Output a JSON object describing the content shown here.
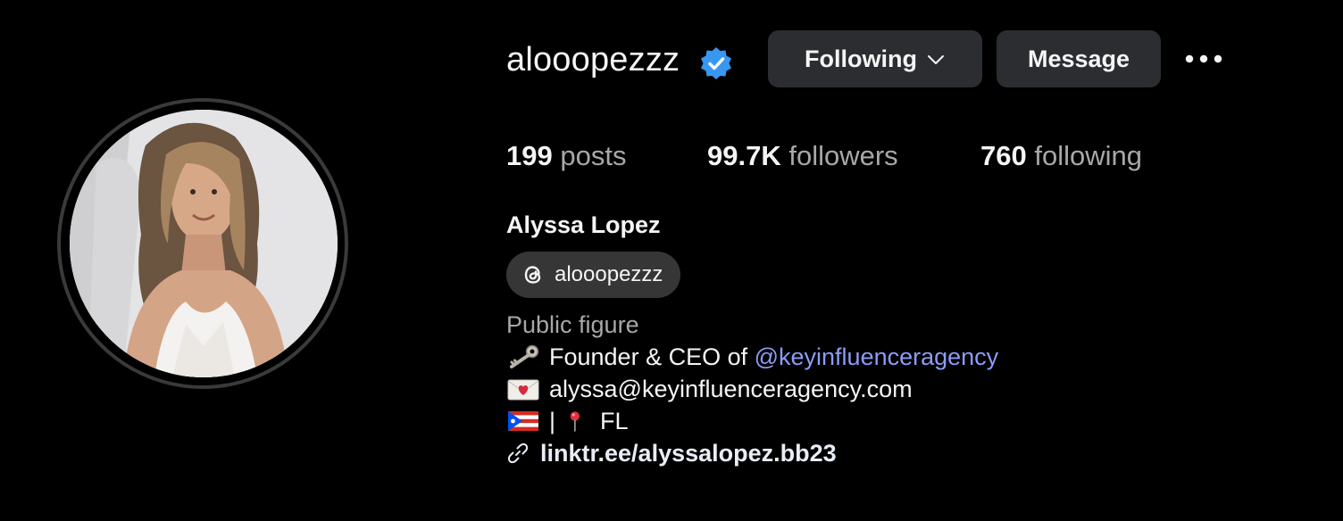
{
  "profile": {
    "username": "alooopezzz",
    "verified": true,
    "full_name": "Alyssa Lopez",
    "category": "Public figure"
  },
  "actions": {
    "following_label": "Following",
    "message_label": "Message",
    "more_icon": "more-horizontal-icon"
  },
  "stats": {
    "posts_count": "199",
    "posts_label": "posts",
    "followers_count": "99.7K",
    "followers_label": "followers",
    "following_count": "760",
    "following_label": "following"
  },
  "threads": {
    "handle": "alooopezzz",
    "icon": "threads-icon"
  },
  "bio": {
    "line1_prefix": "Founder & CEO of ",
    "line1_mention": "@keyinfluenceragency",
    "line1_icon": "key-icon",
    "line2_text": "alyssa@keyinfluenceragency.com",
    "line2_icon": "love-letter-icon",
    "line3_sep": "|",
    "line3_text": "FL",
    "line3_icons": [
      "puerto-rico-flag-icon",
      "pin-icon"
    ]
  },
  "link": {
    "text": "linktr.ee/alyssalopez.bb23",
    "icon": "link-icon"
  },
  "colors": {
    "background": "#000000",
    "button_bg": "#2b2d31",
    "mention": "#8c9cf6",
    "verified": "#3897f0",
    "secondary_text": "#a8a8a8"
  }
}
